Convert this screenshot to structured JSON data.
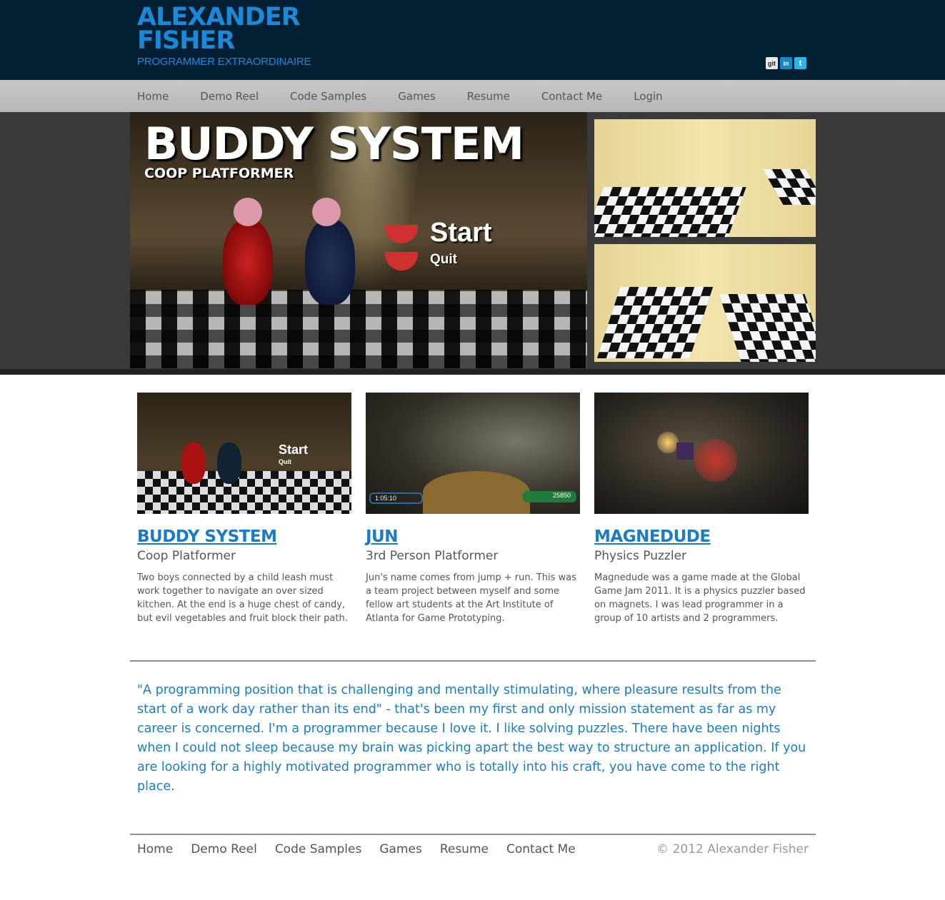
{
  "header": {
    "name_line1": "ALEXANDER",
    "name_line2": "FISHER",
    "tagline": "PROGRAMMER EXTRAORDINAIRE",
    "social": [
      {
        "label": "git",
        "icon": "github-icon"
      },
      {
        "label": "in",
        "icon": "linkedin-icon"
      },
      {
        "label": "t",
        "icon": "twitter-icon"
      }
    ]
  },
  "nav": {
    "items": [
      "Home",
      "Demo Reel",
      "Code Samples",
      "Games",
      "Resume",
      "Contact Me",
      "Login"
    ]
  },
  "hero": {
    "title": "BUDDY SYSTEM",
    "subtitle": "COOP PLATFORMER",
    "menu_start": "Start",
    "menu_quit": "Quit"
  },
  "games": [
    {
      "title": "BUDDY SYSTEM",
      "genre": "Coop Platformer",
      "description": "Two boys connected by a child leash must work together to navigate an over sized kitchen. At the end is a huge chest of candy, but evil vegetables and fruit block their path.",
      "thumb_start": "Start",
      "thumb_quit": "Quit"
    },
    {
      "title": "JUN",
      "genre": "3rd Person Platformer",
      "description": "Jun's name comes from jump + run. This was a team project between myself and some fellow art students at the Art Institute of Atlanta for Game Prototyping.",
      "hud_time": "1:05:10",
      "hud_score": "25850"
    },
    {
      "title": "MAGNEDUDE",
      "genre": "Physics Puzzler",
      "description": "Magnedude was a game made at the Global Game Jam 2011. It is a physics puzzler based on magnets. I was lead programmer in a group of 10 artists and 2 programmers."
    }
  ],
  "mission": "\"A programming position that is challenging and mentally stimulating, where pleasure results from the start of a work day rather than its end\" - that's been my first and only mission statement as far as my career is concerned. I'm a programmer because I love it. I like solving puzzles. There have been nights when I could not sleep because my brain was picking apart the best way to structure an application. If you are looking for a highly motivated programmer who is totally into his craft, you have come to the right place.",
  "footer": {
    "items": [
      "Home",
      "Demo Reel",
      "Code Samples",
      "Games",
      "Resume",
      "Contact Me"
    ],
    "copyright": "© 2012 Alexander Fisher"
  },
  "colors": {
    "header_bg": "#031f33",
    "accent": "#1a7cc4",
    "nav_bg": "#c0c0c0"
  }
}
